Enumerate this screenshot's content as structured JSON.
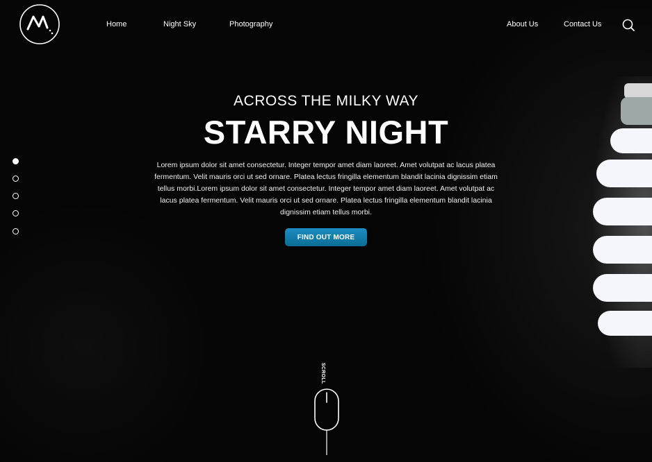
{
  "header": {
    "logo_icon": "mountain-logo-icon",
    "nav": {
      "home": "Home",
      "night_sky": "Night Sky",
      "photography": "Photography",
      "about_us": "About Us",
      "contact_us": "Contact Us"
    },
    "search_icon": "search-icon"
  },
  "side_nav": {
    "count": 5,
    "active_index": 0
  },
  "hero": {
    "subtitle": "ACROSS THE MILKY WAY",
    "title": "STARRY NIGHT",
    "body": "Lorem ipsum dolor sit amet consectetur. Integer tempor amet diam laoreet. Amet volutpat ac lacus platea fermentum. Velit mauris orci ut sed ornare. Platea lectus fringilla elementum blandit lacinia dignissim etiam tellus morbi.Lorem ipsum dolor sit amet consectetur. Integer tempor amet diam laoreet. Amet volutpat ac lacus platea fermentum. Velit mauris orci ut sed ornare. Platea lectus fringilla elementum blandit lacinia dignissim etiam tellus morbi.",
    "cta_label": "FIND OUT MORE"
  },
  "scroll": {
    "label": "SCROLL",
    "icon": "mouse-scroll-icon"
  },
  "colors": {
    "background": "#050505",
    "text": "#ffffff",
    "cta": "#1580ad"
  }
}
